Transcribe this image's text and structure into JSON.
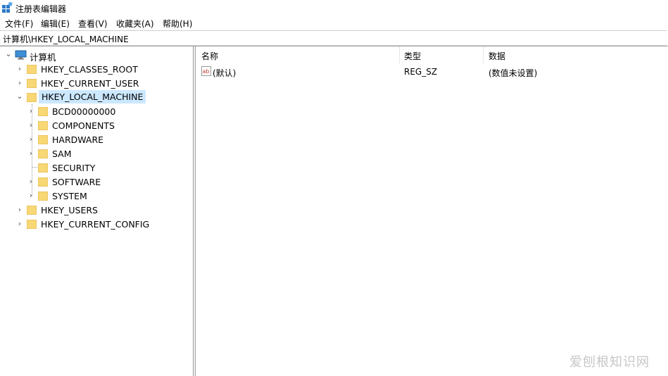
{
  "window": {
    "title": "注册表编辑器"
  },
  "menu": [
    "文件(F)",
    "编辑(E)",
    "查看(V)",
    "收藏夹(A)",
    "帮助(H)"
  ],
  "address": "计算机\\HKEY_LOCAL_MACHINE",
  "tree": {
    "root": "计算机",
    "hives": {
      "classes_root": "HKEY_CLASSES_ROOT",
      "current_user": "HKEY_CURRENT_USER",
      "local_machine": "HKEY_LOCAL_MACHINE",
      "users": "HKEY_USERS",
      "current_config": "HKEY_CURRENT_CONFIG"
    },
    "hklm_children": [
      "BCD00000000",
      "COMPONENTS",
      "HARDWARE",
      "SAM",
      "SECURITY",
      "SOFTWARE",
      "SYSTEM"
    ]
  },
  "list": {
    "columns": {
      "name": "名称",
      "type": "类型",
      "data": "数据"
    },
    "rows": [
      {
        "name": "(默认)",
        "type": "REG_SZ",
        "data": "(数值未设置)"
      }
    ]
  },
  "watermark": "爱刨根知识网",
  "colors": {
    "selection": "#cce8ff",
    "folder": "#f8d775",
    "folder_dark": "#e0b54a",
    "computer": "#3d8fd6"
  }
}
